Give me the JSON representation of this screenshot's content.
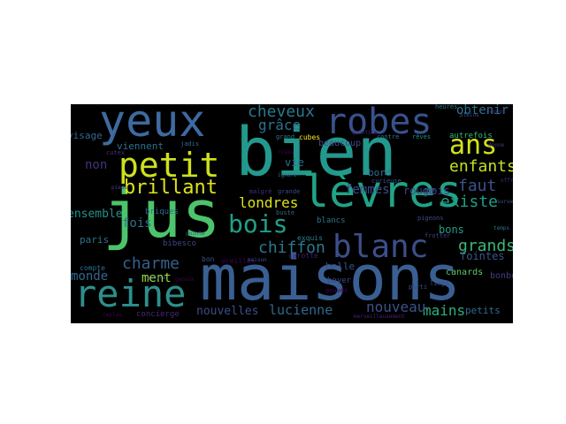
{
  "colors": {
    "background": "#000000",
    "page": "#ffffff"
  },
  "words": [
    {
      "text": "yeux",
      "color": "#3e6aa0"
    },
    {
      "text": "bien",
      "color": "#23998d"
    },
    {
      "text": "jus",
      "color": "#4dc36b"
    },
    {
      "text": "maisons",
      "color": "#3a5f93"
    },
    {
      "text": "petit",
      "color": "#cde11d"
    },
    {
      "text": "robes",
      "color": "#39528e"
    },
    {
      "text": "lèvres",
      "color": "#20a386"
    },
    {
      "text": "reine",
      "color": "#2e8f8d"
    },
    {
      "text": "ans",
      "color": "#d2e21b"
    },
    {
      "text": "brillant",
      "color": "#dde318"
    },
    {
      "text": "bois",
      "color": "#1fa088"
    },
    {
      "text": "blanc",
      "color": "#3c4f8a"
    },
    {
      "text": "cheveux",
      "color": "#2a788e"
    },
    {
      "text": "enfants",
      "color": "#c5e021"
    },
    {
      "text": "charme",
      "color": "#355f8d"
    },
    {
      "text": "chiffon",
      "color": "#2a788e"
    },
    {
      "text": "grands",
      "color": "#38b977"
    },
    {
      "text": "londres",
      "color": "#dde318"
    },
    {
      "text": "grâce",
      "color": "#2d718e"
    },
    {
      "text": "faut",
      "color": "#3b528b"
    },
    {
      "text": "existe",
      "color": "#1f9e89"
    },
    {
      "text": "obtenir",
      "color": "#2c728e"
    },
    {
      "text": "mains",
      "color": "#2ab07f"
    },
    {
      "text": "nouveau",
      "color": "#3b528b"
    },
    {
      "text": "lucienne",
      "color": "#31688e"
    },
    {
      "text": "nouvelles",
      "color": "#3e4c8a"
    },
    {
      "text": "monde",
      "color": "#31688e"
    },
    {
      "text": "ment",
      "color": "#9fda3a"
    },
    {
      "text": "femmes",
      "color": "#3d4e8a"
    },
    {
      "text": "fois",
      "color": "#2c728e"
    },
    {
      "text": "non",
      "color": "#46327e"
    },
    {
      "text": "ensemble",
      "color": "#21918c"
    },
    {
      "text": "vie",
      "color": "#2e6e8e"
    },
    {
      "text": "mois",
      "color": "#424086"
    },
    {
      "text": "rouge",
      "color": "#3e4989"
    },
    {
      "text": "bons",
      "color": "#1f9e89"
    },
    {
      "text": "fointes",
      "color": "#3a548c"
    },
    {
      "text": "viennent",
      "color": "#2c728e"
    },
    {
      "text": "visage",
      "color": "#31688e"
    },
    {
      "text": "beaucoup",
      "color": "#3f4788"
    },
    {
      "text": "bord",
      "color": "#2e6e8e"
    },
    {
      "text": "paris",
      "color": "#2c728e"
    },
    {
      "text": "belle",
      "color": "#3b528b"
    },
    {
      "text": "petits",
      "color": "#2e6e8e"
    },
    {
      "text": "canards",
      "color": "#5ec962"
    },
    {
      "text": "bonbons",
      "color": "#443a83"
    },
    {
      "text": "concierge",
      "color": "#482878"
    },
    {
      "text": "bibesco",
      "color": "#414487"
    },
    {
      "text": "briques",
      "color": "#2f6c8e"
    },
    {
      "text": "boyer",
      "color": "#3f4788"
    },
    {
      "text": "autrefois",
      "color": "#35b779"
    },
    {
      "text": "blancs",
      "color": "#2a788e"
    },
    {
      "text": "exquis",
      "color": "#27808e"
    },
    {
      "text": "compte",
      "color": "#2c718e"
    },
    {
      "text": "bon",
      "color": "#3b528b"
    },
    {
      "text": "oreilles",
      "color": "#440154"
    },
    {
      "text": "carotte",
      "color": "#481b6d"
    },
    {
      "text": "linge",
      "color": "#3b528b"
    },
    {
      "text": "pigeons",
      "color": "#3e4a89"
    },
    {
      "text": "frotter",
      "color": "#424186"
    },
    {
      "text": "cubes",
      "color": "#fde725"
    },
    {
      "text": "grand",
      "color": "#2a788e"
    },
    {
      "text": "rêves",
      "color": "#21908d"
    },
    {
      "text": "contre",
      "color": "#2c728e"
    },
    {
      "text": "curieuse",
      "color": "#3b528b"
    },
    {
      "text": "buste",
      "color": "#31688e"
    },
    {
      "text": "malgré",
      "color": "#46307e"
    },
    {
      "text": "grande",
      "color": "#3e4989"
    },
    {
      "text": "cutex",
      "color": "#472f7d"
    },
    {
      "text": "jadis",
      "color": "#2f6b8e"
    },
    {
      "text": "parti",
      "color": "#3b528b"
    },
    {
      "text": "pouvez",
      "color": "#440154"
    },
    {
      "text": "heures",
      "color": "#2a788e"
    },
    {
      "text": "pleins",
      "color": "#3e4989"
    },
    {
      "text": "propos",
      "color": "#46307e"
    },
    {
      "text": "donne",
      "color": "#443b84"
    },
    {
      "text": "offrir",
      "color": "#472d7b"
    },
    {
      "text": "surveiller",
      "color": "#3b528b"
    },
    {
      "text": "ignore",
      "color": "#2c728e"
    },
    {
      "text": "roses",
      "color": "#440154"
    },
    {
      "text": "gloire",
      "color": "#3b528b"
    },
    {
      "text": "ceplas",
      "color": "#440154"
    },
    {
      "text": "merveilleusement",
      "color": "#482173"
    },
    {
      "text": "quantité",
      "color": "#472c7a"
    },
    {
      "text": "pointe",
      "color": "#3b528b"
    },
    {
      "text": "genoux",
      "color": "#440154"
    },
    {
      "text": "maison",
      "color": "#3b528b"
    },
    {
      "text": "pieds",
      "color": "#414487"
    },
    {
      "text": "temps",
      "color": "#2c728e"
    }
  ]
}
